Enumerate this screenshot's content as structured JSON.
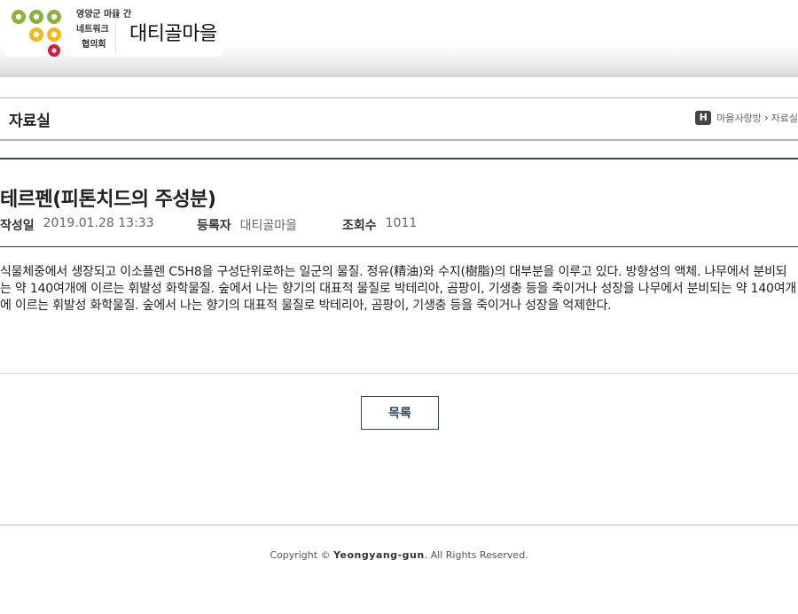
{
  "header": {
    "logo_lines": [
      "영양군 마을 간",
      "네트워크",
      "협의회"
    ],
    "village_name": "대티골마을"
  },
  "section": {
    "title": "자료실",
    "breadcrumb": {
      "home_icon_letter": "H",
      "items": [
        "마을사랑방",
        "자료실"
      ]
    }
  },
  "article": {
    "title": "테르펜(피톤치드의 주성분)",
    "meta": {
      "date_label": "작성일",
      "date": "2019.01.28 13:33",
      "author_label": "등록자",
      "author": "대티골마을",
      "views_label": "조회수",
      "views": "1011"
    },
    "body": "식물체중에서 생장되고 이소플렌 C5H8을 구성단위로하는 일군의 물질. 정유(精油)와 수지(樹脂)의 대부분을 이루고 있다. 방향성의 액체. 나무에서 분비되는 약 140여개에 이르는 휘발성 화학물질. 숲에서 나는 향기의 대표적 물질로 박테리아, 곰팡이, 기생충 등을 죽이거나 성장을 나무에서 분비되는 약 140여개에 이르는 휘발성 화학물질. 숲에서 나는 향기의 대표적 물질로 박테리아, 곰팡이, 기생충 등을 죽이거나 성장을 억제한다."
  },
  "list_button_label": "목록",
  "footer": {
    "prefix": "Copyright © ",
    "brand": "Yeongyang-gun",
    "suffix": ". All Rights Reserved."
  },
  "colors": {
    "accent": "#34495e",
    "logo_green": "#8cb03c",
    "logo_yellow": "#f2b81c",
    "logo_red": "#d7193a"
  }
}
